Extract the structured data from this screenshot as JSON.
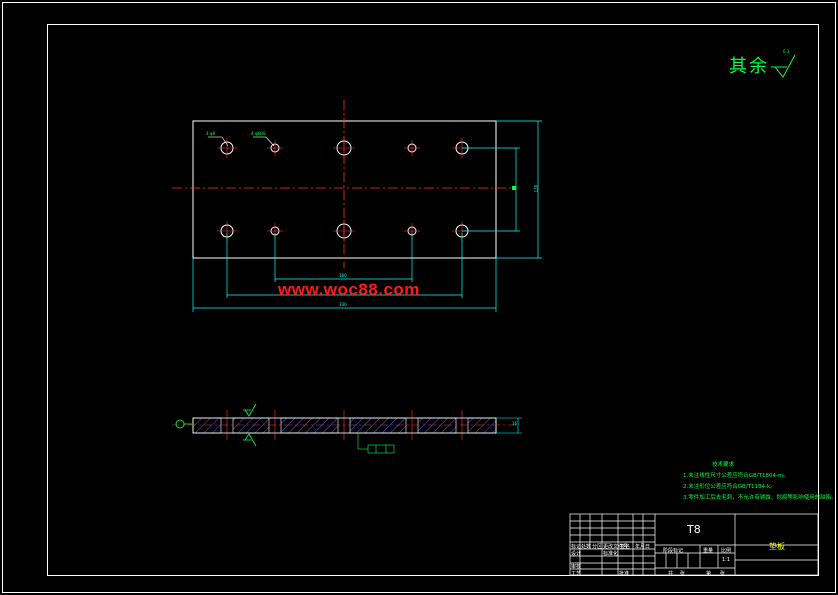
{
  "watermark": "www.woc88.com",
  "roughness": {
    "label": "其余",
    "value": "6.3"
  },
  "technical_requirements": {
    "title": "技术要求",
    "lines": [
      "1.未注线性尺寸公差应符合GB/T1804-m。",
      "2.未注形位公差应符合GB/T1184-k。",
      "3.零件加工后去毛刺，不允许有锈蚀、划痕等影响使用的缺陷。"
    ]
  },
  "title_block": {
    "material": "T8",
    "part_name": "垫板",
    "header_cells": [
      "标记",
      "处数",
      "分区",
      "更改文件号",
      "签名",
      "年月日"
    ],
    "row_labels": [
      "设计",
      "标准化",
      "审核",
      "工艺",
      "批准"
    ],
    "stage_label": "阶段标记",
    "weight_label": "重量",
    "scale_label": "比例",
    "scale_value": "1:1",
    "sheet_info": [
      "共",
      "张",
      "第",
      "张"
    ]
  },
  "dimensions": {
    "overall_length": "330",
    "hole_span_inner": "160",
    "height": "130",
    "thickness": "16",
    "hole_callout_1": "4-φ9",
    "hole_callout_2": "4-φ6H8"
  }
}
